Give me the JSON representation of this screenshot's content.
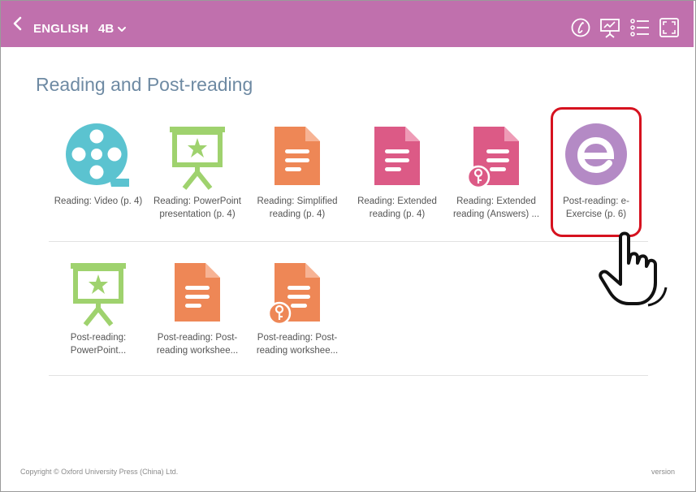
{
  "header": {
    "subject": "ENGLISH",
    "grade": "4B",
    "icons": [
      "back-icon",
      "chevron-down-icon",
      "info-script-icon",
      "presentation-icon",
      "list-icon",
      "fullscreen-icon"
    ],
    "bar_color": "#c070ad"
  },
  "page": {
    "title": "Reading and Post-reading"
  },
  "resources_row1": [
    {
      "label1": "Reading: Video (p. 4)",
      "label2": "",
      "icon": "video-reel-icon"
    },
    {
      "label1": "Reading: PowerPoint",
      "label2": "presentation (p. 4)",
      "icon": "presentation-board-icon"
    },
    {
      "label1": "Reading: Simplified",
      "label2": "reading (p. 4)",
      "icon": "document-icon"
    },
    {
      "label1": "Reading: Extended",
      "label2": "reading (p. 4)",
      "icon": "document-icon"
    },
    {
      "label1": "Reading: Extended",
      "label2": "reading (Answers) ...",
      "icon": "document-key-icon"
    },
    {
      "label1": "Post-reading: e-",
      "label2": "Exercise (p. 6)",
      "icon": "e-exercise-icon"
    }
  ],
  "resources_row2": [
    {
      "label1": "Post-reading:",
      "label2": "PowerPoint...",
      "icon": "presentation-board-icon"
    },
    {
      "label1": "Post-reading: Post-",
      "label2": "reading workshee...",
      "icon": "document-icon"
    },
    {
      "label1": "Post-reading: Post-",
      "label2": "reading workshee...",
      "icon": "document-key-icon"
    }
  ],
  "footer": {
    "copyright": "Copyright © Oxford University Press (China) Ltd.",
    "version": "version"
  },
  "colors": {
    "video": "#5bc3d0",
    "presentation": "#9fd26e",
    "doc_orange": "#ee8756",
    "doc_pink": "#dc5a86",
    "e_exercise": "#b48ac5",
    "highlight": "#d6121f"
  }
}
